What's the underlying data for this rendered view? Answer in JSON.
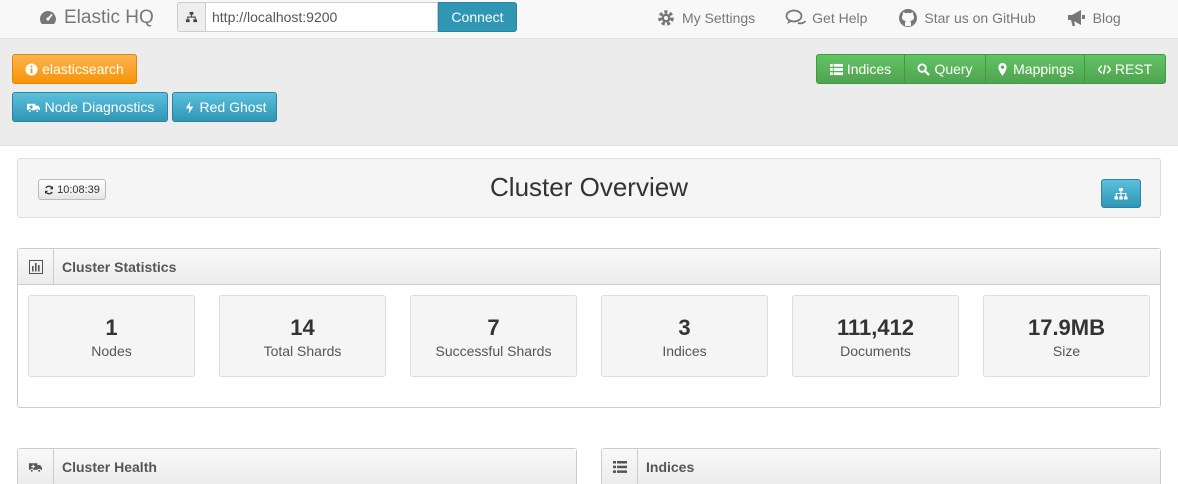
{
  "brand": {
    "name": "Elastic HQ"
  },
  "connect": {
    "url": "http://localhost:9200",
    "button_label": "Connect"
  },
  "nav": {
    "settings": "My Settings",
    "help": "Get Help",
    "github": "Star us on GitHub",
    "blog": "Blog"
  },
  "actions": {
    "cluster_name": "elasticsearch",
    "node_diagnostics": "Node Diagnostics",
    "node_name": "Red Ghost",
    "indices": "Indices",
    "query": "Query",
    "mappings": "Mappings",
    "rest": "REST"
  },
  "overview": {
    "title": "Cluster Overview",
    "refresh_time": "10:08:39"
  },
  "stats": {
    "title": "Cluster Statistics",
    "items": [
      {
        "value": "1",
        "label": "Nodes"
      },
      {
        "value": "14",
        "label": "Total Shards"
      },
      {
        "value": "7",
        "label": "Successful Shards"
      },
      {
        "value": "3",
        "label": "Indices"
      },
      {
        "value": "111,412",
        "label": "Documents"
      },
      {
        "value": "17.9MB",
        "label": "Size"
      }
    ]
  },
  "health": {
    "title": "Cluster Health"
  },
  "indices_panel": {
    "title": "Indices"
  },
  "colors": {
    "info": "#2f96b4",
    "warning": "#f89406",
    "success": "#51a351"
  }
}
